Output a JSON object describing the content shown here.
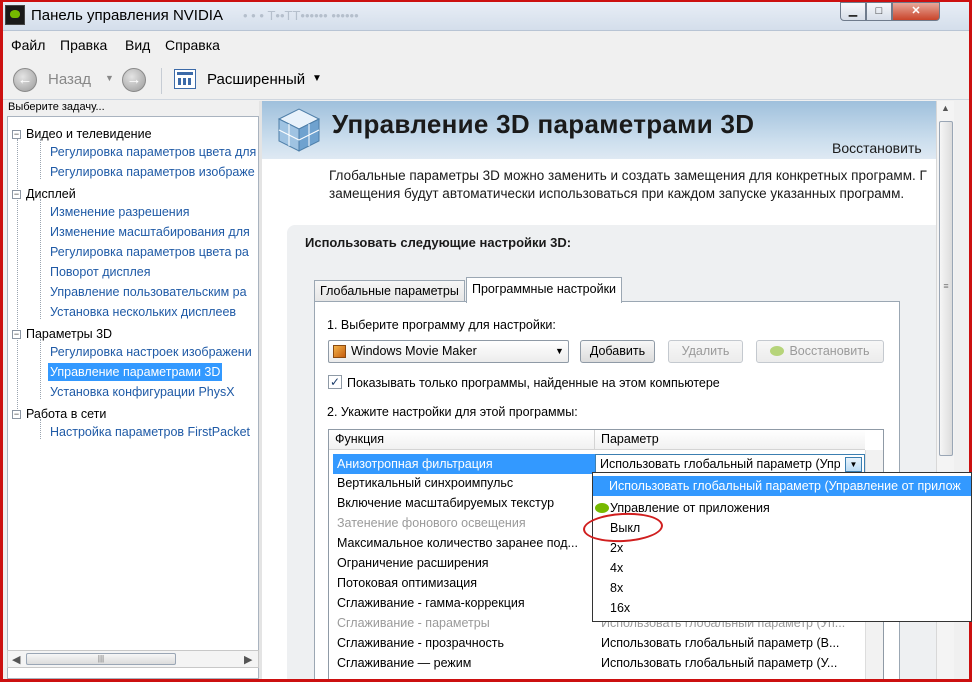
{
  "window": {
    "title": "Панель управления NVIDIA",
    "ghost_text": "• • •  Т••ТТ•••••• ••••••"
  },
  "caption_buttons": {
    "minimize": "▁",
    "maximize": "□",
    "close": "✕"
  },
  "menu": [
    "Файл",
    "Правка",
    "Вид",
    "Справка"
  ],
  "toolbar": {
    "back_label": "Назад",
    "view_label": "Расширенный",
    "back_icon": "arrow-left",
    "fwd_icon": "arrow-right"
  },
  "sidebar": {
    "task_label": "Выберите задачу...",
    "categories": [
      {
        "label": "Видео и телевидение",
        "items": [
          "Регулировка параметров цвета для",
          "Регулировка параметров изображе"
        ]
      },
      {
        "label": "Дисплей",
        "items": [
          "Изменение разрешения",
          "Изменение масштабирования для",
          "Регулировка параметров цвета ра",
          "Поворот дисплея",
          "Управление пользовательским ра",
          "Установка нескольких дисплеев"
        ]
      },
      {
        "label": "Параметры 3D",
        "items": [
          "Регулировка настроек изображени",
          "Управление параметрами 3D",
          "Установка конфигурации PhysX"
        ]
      },
      {
        "label": "Работа в сети",
        "items": [
          "Настройка параметров FirstPacket"
        ]
      }
    ],
    "selected": "Управление параметрами 3D",
    "expander": "−"
  },
  "main": {
    "title": "Управление 3D параметрами 3D",
    "restore": "Восстановить",
    "description": "Глобальные параметры 3D можно заменить и создать замещения для конкретных программ. Г замещения будут автоматически использоваться при каждом запуске указанных программ.",
    "use_label": "Использовать следующие настройки 3D:",
    "tabs": [
      "Глобальные параметры",
      "Программные настройки"
    ],
    "active_tab": "Программные настройки",
    "step1": "1. Выберите программу для настройки:",
    "program": "Windows Movie Maker",
    "buttons": {
      "add": "Добавить",
      "remove": "Удалить",
      "restore": "Восстановить"
    },
    "checkbox_label": "Показывать только программы, найденные на этом компьютере",
    "checkbox_checked": true,
    "checkmark": "✓",
    "step2": "2. Укажите настройки для этой программы:",
    "table": {
      "headers": [
        "Функция",
        "Параметр"
      ],
      "rows": [
        {
          "func": "Анизотропная фильтрация",
          "param": "Использовать глобальный параметр (Упр",
          "selected": true
        },
        {
          "func": "Вертикальный синхроимпульс",
          "param": ""
        },
        {
          "func": "Включение масштабируемых текстур",
          "param": ""
        },
        {
          "func": "Затенение фонового освещения",
          "param": "",
          "disabled": true
        },
        {
          "func": "Максимальное количество заранее под...",
          "param": ""
        },
        {
          "func": "Ограничение расширения",
          "param": ""
        },
        {
          "func": "Потоковая оптимизация",
          "param": ""
        },
        {
          "func": "Сглаживание - гамма-коррекция",
          "param": ""
        },
        {
          "func": "Сглаживание - параметры",
          "param": "Использовать глобальный параметр (Уп...",
          "disabled": true
        },
        {
          "func": "Сглаживание - прозрачность",
          "param": "Использовать глобальный параметр (В..."
        },
        {
          "func": "Сглаживание — режим",
          "param": "Использовать глобальный параметр (У..."
        }
      ]
    },
    "dropdown_arrow": "▼",
    "combo_arrow": "▼"
  },
  "dropdown": {
    "items": [
      "Использовать глобальный параметр (Управление от прилож",
      "Управление от приложения",
      "Выкл",
      "2x",
      "4x",
      "8x",
      "16x"
    ],
    "highlighted_index": 0,
    "annotated_item": "Выкл",
    "annotation_color": "#d01e1e"
  },
  "scrollbars": {
    "up": "▲",
    "left": "◀",
    "right": "▶",
    "grip": "≡",
    "hgrip": "|||"
  },
  "colors": {
    "accent": "#3399ff",
    "nvidia_green": "#76b900",
    "link": "#1f5aa6",
    "frame": "#cc1010"
  }
}
